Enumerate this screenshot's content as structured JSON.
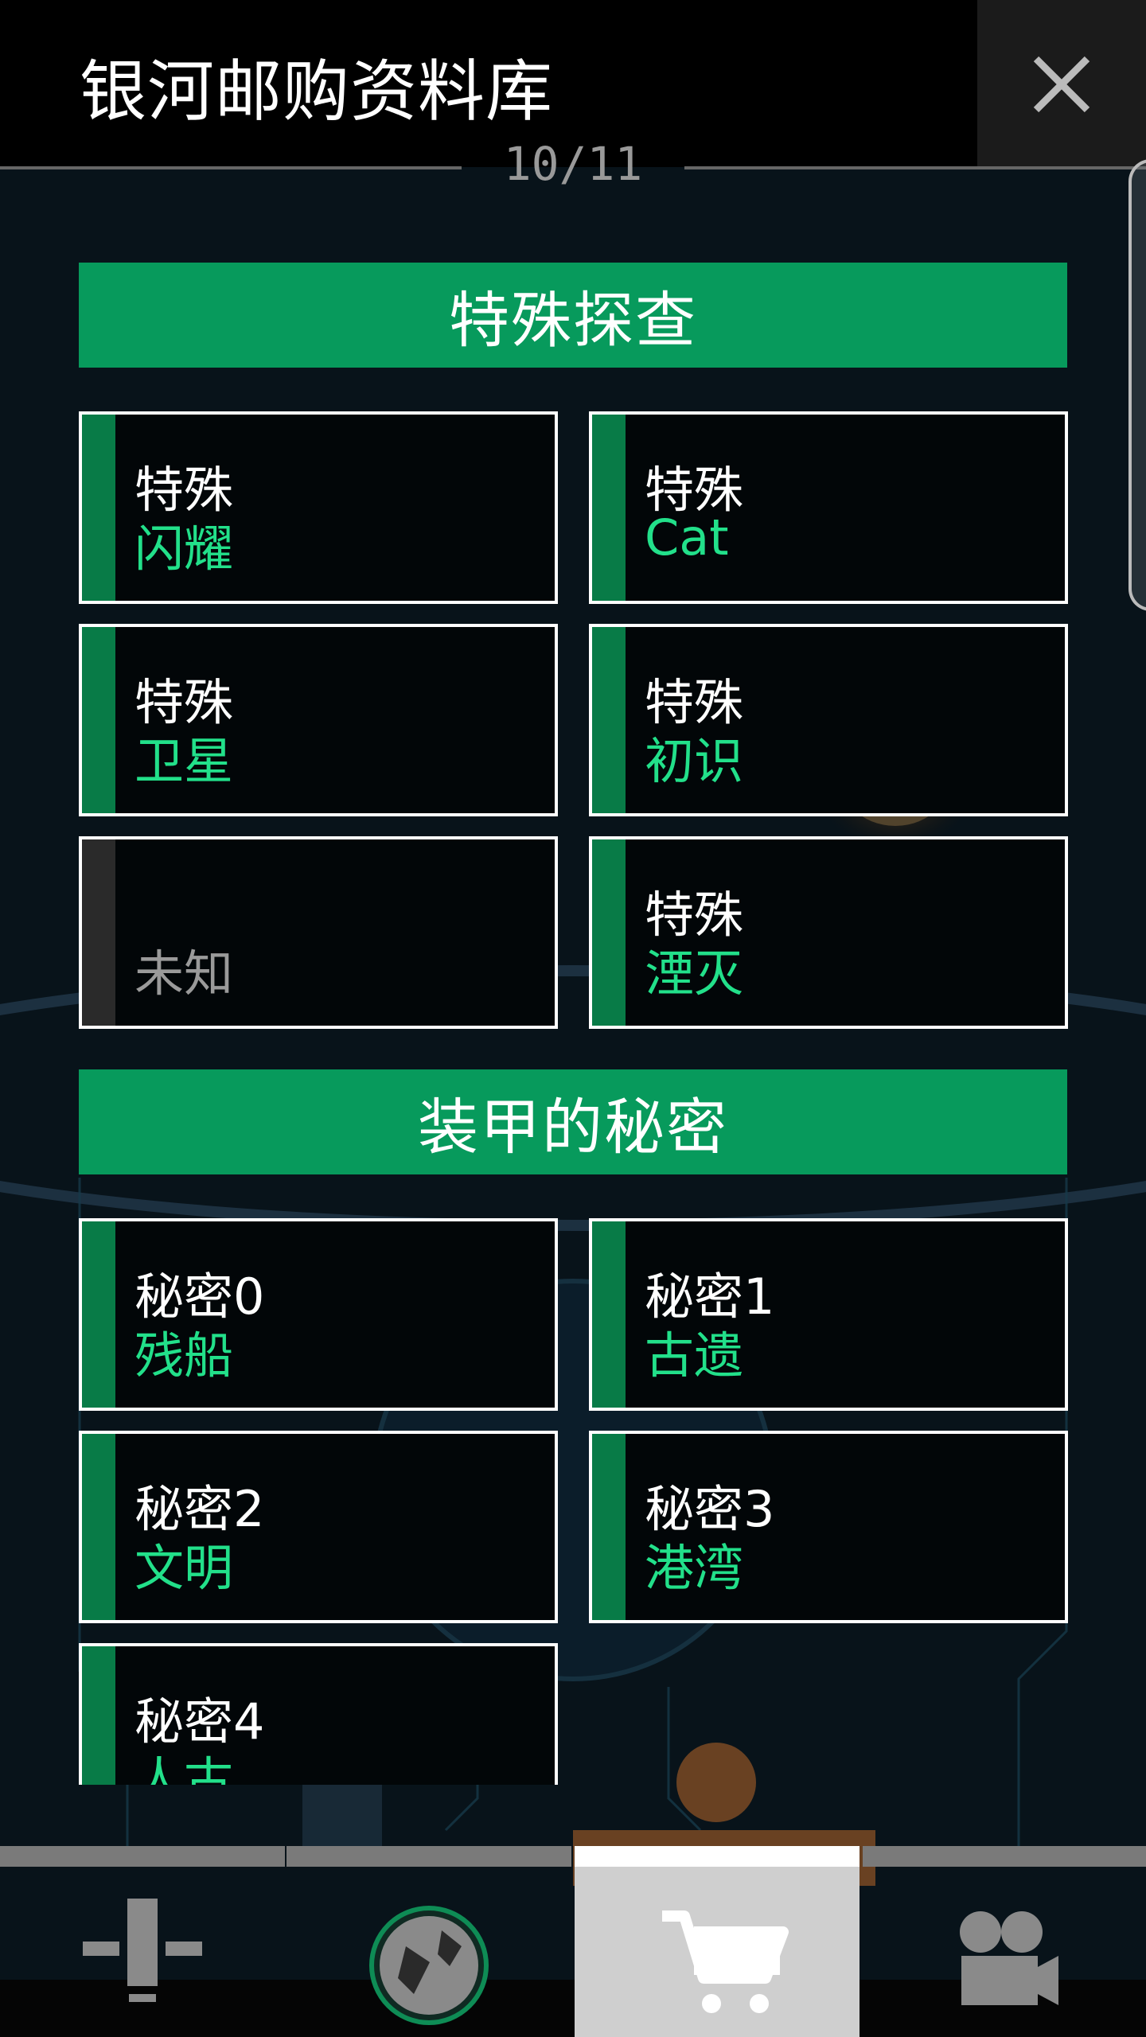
{
  "header": {
    "title": "银河邮购资料库",
    "page_indicator": "10/11"
  },
  "sections": [
    {
      "title": "特殊探查",
      "cards": [
        {
          "line1": "特殊",
          "line2": "闪耀",
          "locked": false
        },
        {
          "line1": "特殊",
          "line2": "Cat",
          "locked": false
        },
        {
          "line1": "特殊",
          "line2": "卫星",
          "locked": false
        },
        {
          "line1": "特殊",
          "line2": "初识",
          "locked": false
        },
        {
          "line1": "",
          "line2": "未知",
          "locked": true
        },
        {
          "line1": "特殊",
          "line2": "湮灭",
          "locked": false
        }
      ]
    },
    {
      "title": "装甲的秘密",
      "cards": [
        {
          "line1": "秘密0",
          "line2": "残船",
          "locked": false
        },
        {
          "line1": "秘密1",
          "line2": "古遗",
          "locked": false
        },
        {
          "line1": "秘密2",
          "line2": "文明",
          "locked": false
        },
        {
          "line1": "秘密3",
          "line2": "港湾",
          "locked": false
        },
        {
          "line1": "秘密4",
          "line2": "人古",
          "locked": false
        }
      ]
    }
  ],
  "bottom_nav": [
    {
      "icon": "building-icon",
      "active": false
    },
    {
      "icon": "planet-icon",
      "active": false
    },
    {
      "icon": "cart-icon",
      "active": true
    },
    {
      "icon": "camera-icon",
      "active": false
    }
  ],
  "colors": {
    "accent_green": "#079a5c",
    "label_green": "#22e08a",
    "stripe_green": "#087b47"
  }
}
